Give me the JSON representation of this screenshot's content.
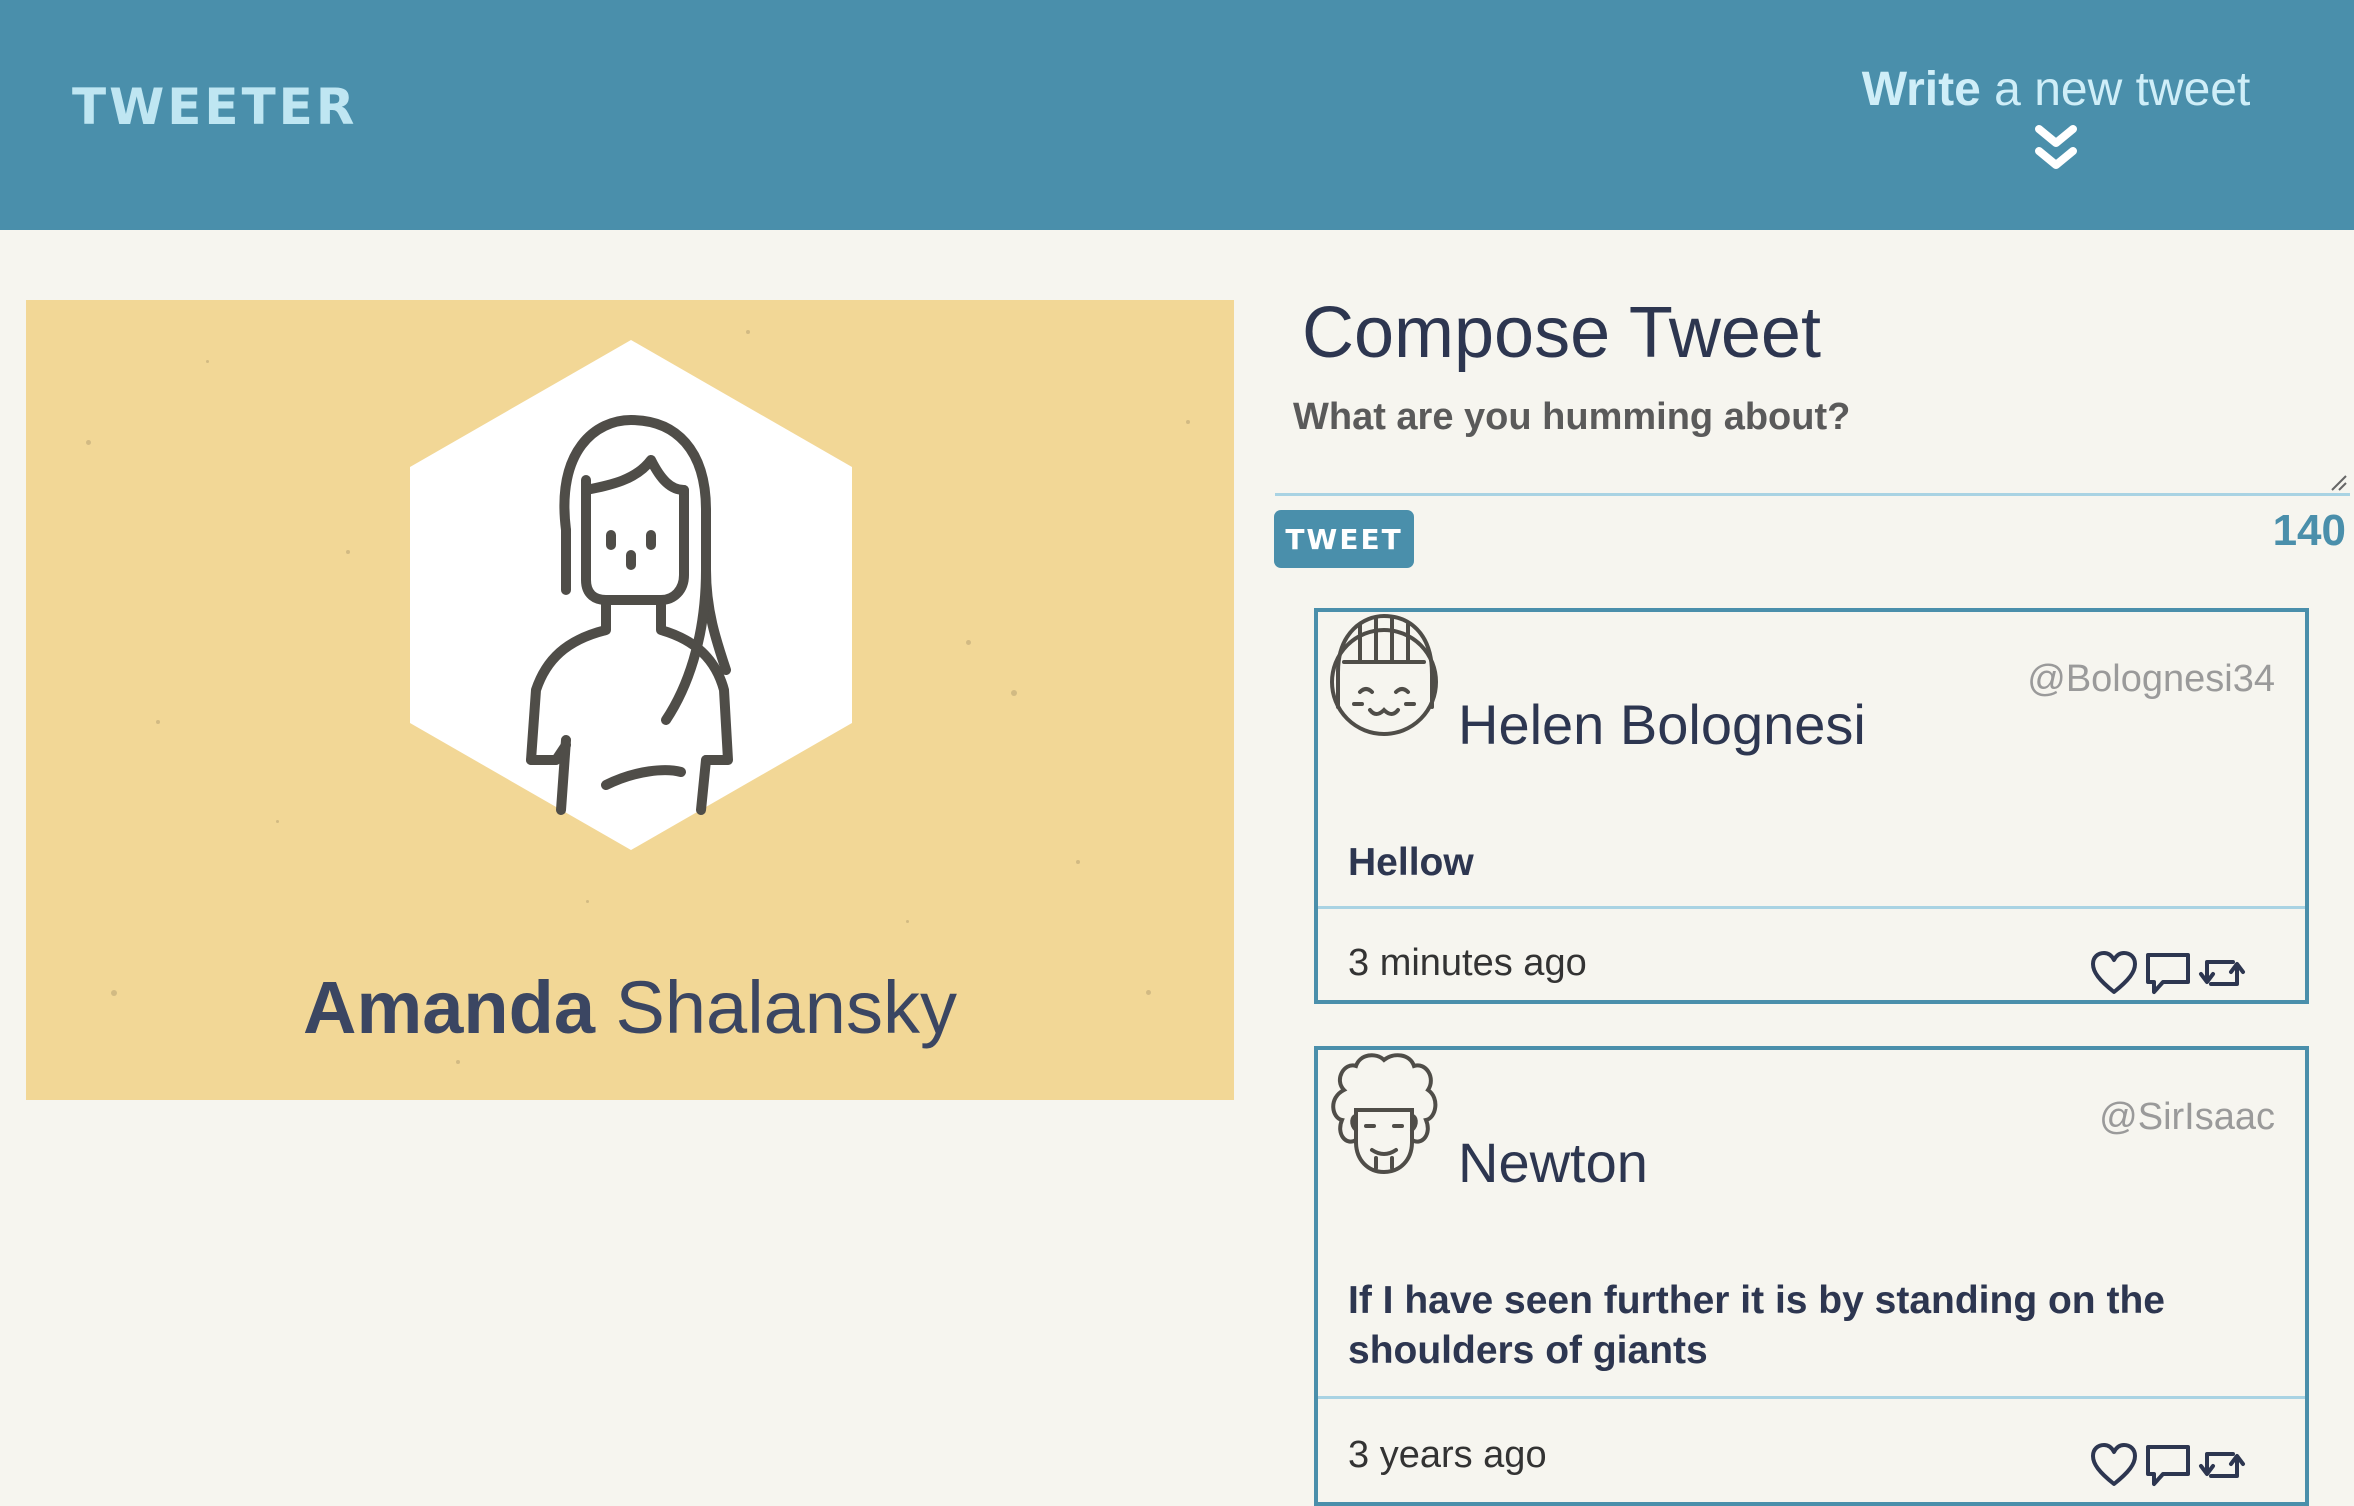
{
  "nav": {
    "brand": "TWEETER",
    "compose_toggle_bold": "Write",
    "compose_toggle_rest": " a new tweet"
  },
  "profile": {
    "first_name": "Amanda",
    "last_name": "Shalansky"
  },
  "compose": {
    "title": "Compose Tweet",
    "placeholder": "What are you humming about?",
    "button_label": "TWEET",
    "counter": "140"
  },
  "tweets": [
    {
      "name": "Helen Bolognesi",
      "handle": "@Bolognesi34",
      "text": "Hellow",
      "time": "3 minutes ago"
    },
    {
      "name": "Newton",
      "handle": "@SirIsaac",
      "text": "If I have seen further it is by standing on the shoulders of giants",
      "time": "3 years ago"
    }
  ],
  "colors": {
    "header": "#4a8fab",
    "background": "#f6f5ef",
    "profile_card": "#f2d796",
    "text_dark": "#2d3650",
    "accent_light": "#a9d3e3"
  },
  "icons": [
    "chevron-double-down-icon",
    "heart-icon",
    "comment-icon",
    "retweet-icon"
  ]
}
